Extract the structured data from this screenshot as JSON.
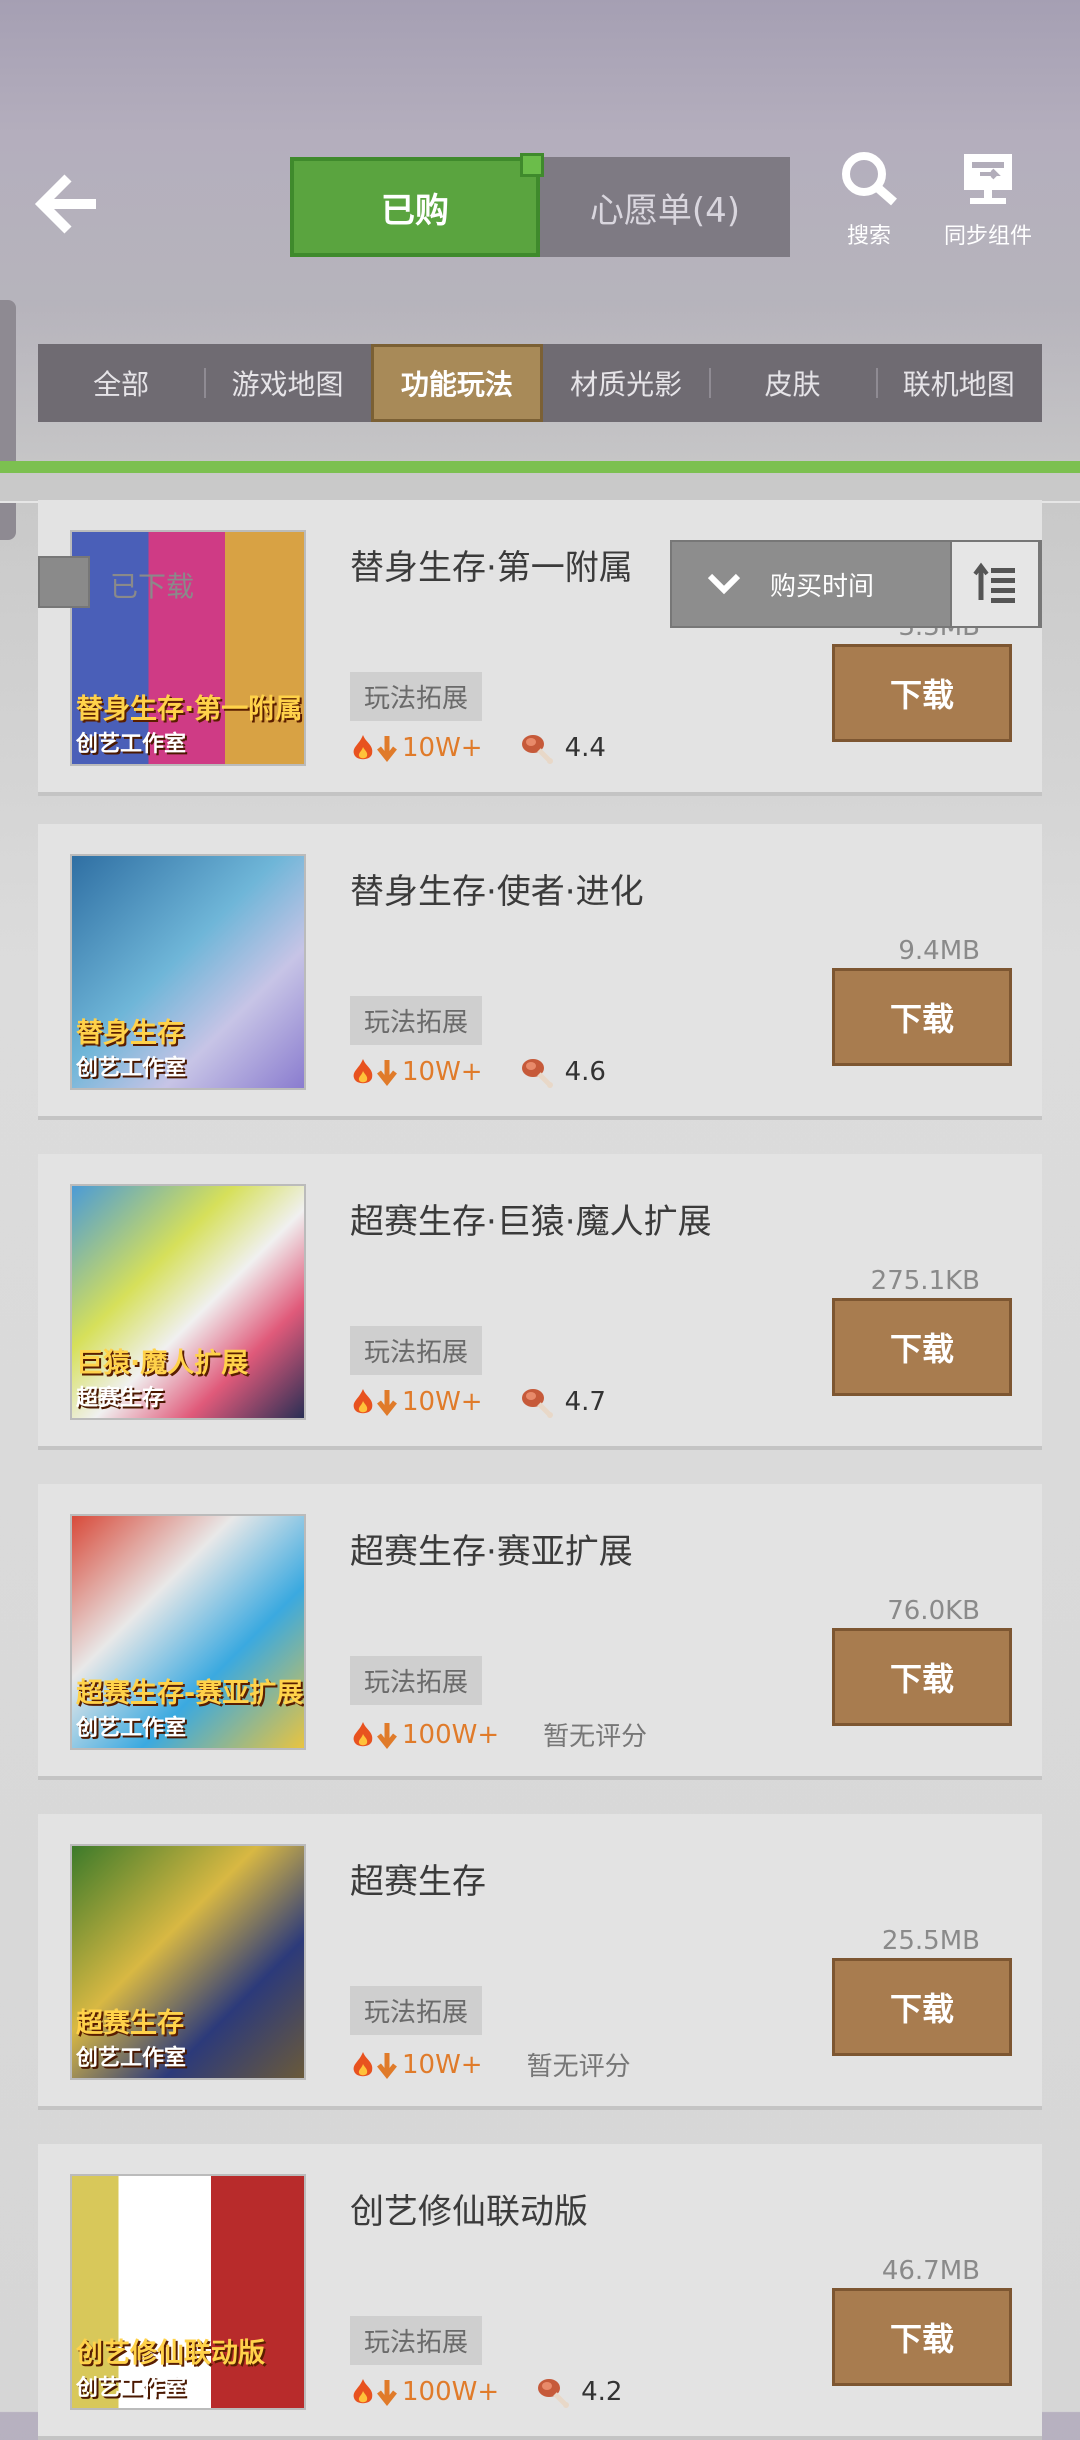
{
  "header": {
    "tabs": [
      {
        "label": "已购",
        "active": true
      },
      {
        "label": "心愿单(4)",
        "active": false
      }
    ],
    "actions": [
      {
        "label": "搜索",
        "icon": "search-icon"
      },
      {
        "label": "同步组件",
        "icon": "sync-icon"
      }
    ]
  },
  "category_tabs": [
    {
      "label": "全部"
    },
    {
      "label": "游戏地图"
    },
    {
      "label": "功能玩法",
      "active": true
    },
    {
      "label": "材质光影"
    },
    {
      "label": "皮肤"
    },
    {
      "label": "联机地图"
    }
  ],
  "filter": {
    "label": "已下载"
  },
  "sort": {
    "label": "购买时间"
  },
  "items": [
    {
      "title": "替身生存·第一附属",
      "size": "3.3MB",
      "tag": "玩法拓展",
      "downloads": "10W+",
      "rating": "4.4",
      "button": "下载",
      "thumb_cap1": "替身生存·第一附属",
      "thumb_cap2": "创艺工作室"
    },
    {
      "title": "替身生存·使者·进化",
      "size": "9.4MB",
      "tag": "玩法拓展",
      "downloads": "10W+",
      "rating": "4.6",
      "button": "下载",
      "thumb_cap1": "替身生存",
      "thumb_cap2": "创艺工作室"
    },
    {
      "title": "超赛生存·巨猿·魔人扩展",
      "size": "275.1KB",
      "tag": "玩法拓展",
      "downloads": "10W+",
      "rating": "4.7",
      "button": "下载",
      "thumb_cap1": "巨猿·魔人扩展",
      "thumb_cap2": "超赛生存"
    },
    {
      "title": "超赛生存·赛亚扩展",
      "size": "76.0KB",
      "tag": "玩法拓展",
      "downloads": "100W+",
      "no_rating": "暂无评分",
      "button": "下载",
      "thumb_cap1": "超赛生存-赛亚扩展",
      "thumb_cap2": "创艺工作室"
    },
    {
      "title": "超赛生存",
      "size": "25.5MB",
      "tag": "玩法拓展",
      "downloads": "10W+",
      "no_rating": "暂无评分",
      "button": "下载",
      "thumb_cap1": "超赛生存",
      "thumb_cap2": "创艺工作室"
    },
    {
      "title": "创艺修仙联动版",
      "size": "46.7MB",
      "tag": "玩法拓展",
      "downloads": "100W+",
      "rating": "4.2",
      "button": "下载",
      "thumb_cap1": "创艺修仙联动版",
      "thumb_cap2": "创艺工作室"
    }
  ],
  "colors": {
    "accent_green": "#5aa43f",
    "download_button": "#a87c4f",
    "active_tab": "#a88a58",
    "download_count": "#e07b2a"
  }
}
